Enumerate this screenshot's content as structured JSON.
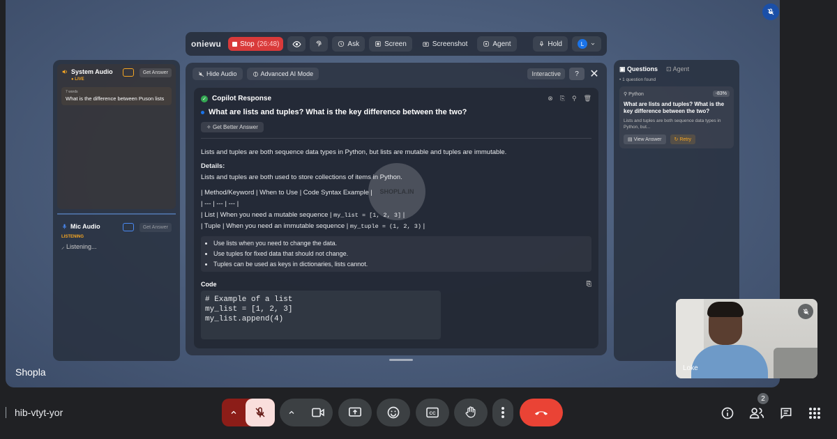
{
  "stage": {
    "participant_name": "Shopla"
  },
  "toolbar": {
    "logo": "oniewu",
    "stop_label": "Stop",
    "timer": "(26:48)",
    "ask_label": "Ask",
    "screen_label": "Screen",
    "screenshot_label": "Screenshot",
    "agent_label": "Agent",
    "hold_label": "Hold",
    "avatar_letter": "L"
  },
  "left_panel": {
    "system_audio_title": "System Audio",
    "live_label": "● LIVE",
    "get_answer_label": "Get Answer",
    "word_count": "7 words",
    "transcript": "What is the difference between Puson lists",
    "mic_audio_title": "Mic Audio",
    "listening_label": "LISTENING",
    "listening_text": "Listening..."
  },
  "main_panel": {
    "hide_audio_label": "Hide Audio",
    "advanced_ai_label": "Advanced AI Mode",
    "interactive_label": "Interactive",
    "help_label": "?",
    "response_title": "Copilot Response",
    "question": "What are lists and tuples? What is the key difference between the two?",
    "better_answer_label": "Get Better Answer",
    "answer_summary": "Lists and tuples are both sequence data types in Python, but lists are mutable and tuples are immutable.",
    "details_heading": "Details:",
    "details_text": "Lists and tuples are both used to store collections of items in Python.",
    "table_lines": [
      "| Method/Keyword | When to Use | Code Syntax Example |",
      "| --- | --- | --- |"
    ],
    "list_row_text": "| List | When you need a mutable sequence |",
    "list_row_code": "my_list = [1, 2, 3]",
    "tuple_row_text": "| Tuple | When you need an immutable sequence |",
    "tuple_row_code": "my_tuple = (1, 2, 3)",
    "row_end": "|",
    "bullets": [
      "Use lists when you need to change the data.",
      "Use tuples for fixed data that should not change.",
      "Tuples can be used as keys in dictionaries, lists cannot."
    ],
    "code_label": "Code",
    "code": "# Example of a list\nmy_list = [1, 2, 3]\nmy_list.append(4)",
    "watermark": "SHOPLA.IN"
  },
  "right_panel": {
    "questions_tab": "Questions",
    "agent_tab": "Agent",
    "found_text": "1 question found",
    "card_language": "Python",
    "card_score": "-83%",
    "card_question": "What are lists and tuples? What is the key difference between the two?",
    "card_preview": "Lists and tuples are both sequence data types in Python, but...",
    "view_answer_label": "View Answer",
    "retry_label": "Retry"
  },
  "self_view": {
    "name": "Loke"
  },
  "bottom_bar": {
    "meeting_code": "hib-vtyt-yor",
    "people_count": "2"
  }
}
